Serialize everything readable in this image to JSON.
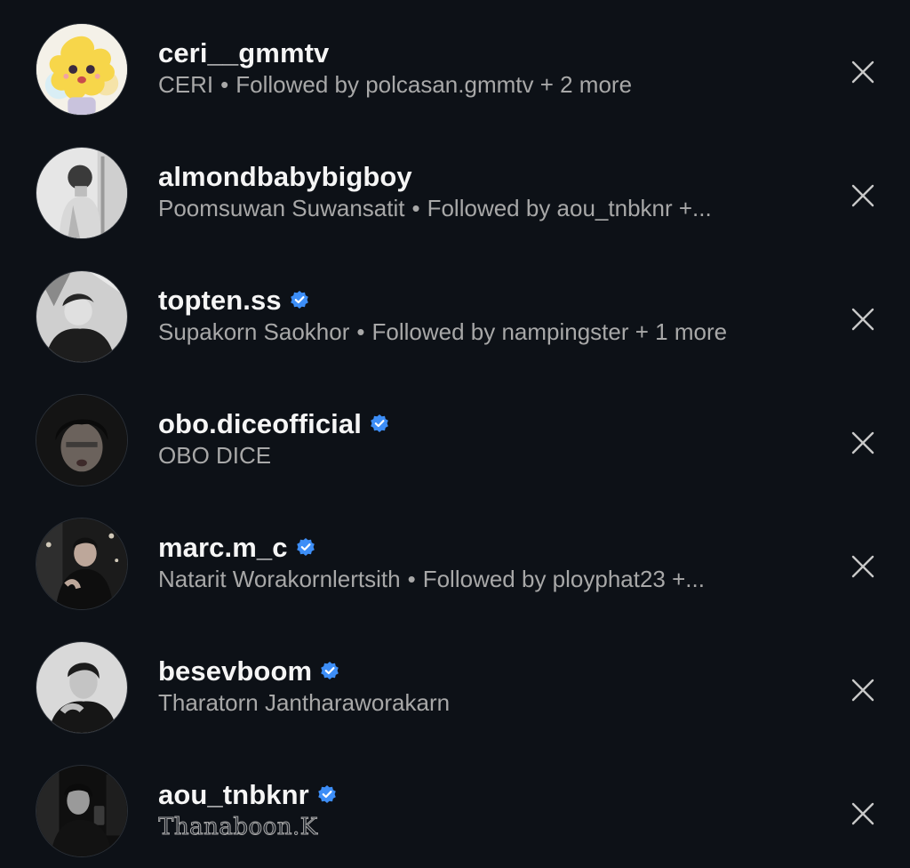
{
  "colors": {
    "background": "#0d1117",
    "username": "#f5f5f5",
    "subtitle": "#a8a8a8",
    "verified": "#3d8ef7",
    "close": "#c8c8c8"
  },
  "icons": {
    "verified": "verified-badge-icon",
    "dismiss": "close-icon"
  },
  "suggestions": [
    {
      "username": "ceri__gmmtv",
      "verified": false,
      "full_name": "CERI",
      "separator": "•",
      "followed_by": "Followed by polcasan.gmmtv + 2 more"
    },
    {
      "username": "almondbabybigboy",
      "verified": false,
      "full_name": "Poomsuwan Suwansatit",
      "separator": "•",
      "followed_by": "Followed by aou_tnbknr +..."
    },
    {
      "username": "topten.ss",
      "verified": true,
      "full_name": "Supakorn Saokhor",
      "separator": "•",
      "followed_by": "Followed by nampingster + 1 more"
    },
    {
      "username": "obo.diceofficial",
      "verified": true,
      "full_name": "OBO DICE",
      "separator": "",
      "followed_by": ""
    },
    {
      "username": "marc.m_c",
      "verified": true,
      "full_name": "Natarit Worakornlertsith",
      "separator": "•",
      "followed_by": "Followed by ployphat23 +..."
    },
    {
      "username": "besevboom",
      "verified": true,
      "full_name": "Tharatorn Jantharaworakarn",
      "separator": "",
      "followed_by": ""
    },
    {
      "username": "aou_tnbknr",
      "verified": true,
      "full_name": "Thanaboon.K",
      "separator": "",
      "followed_by": ""
    }
  ]
}
